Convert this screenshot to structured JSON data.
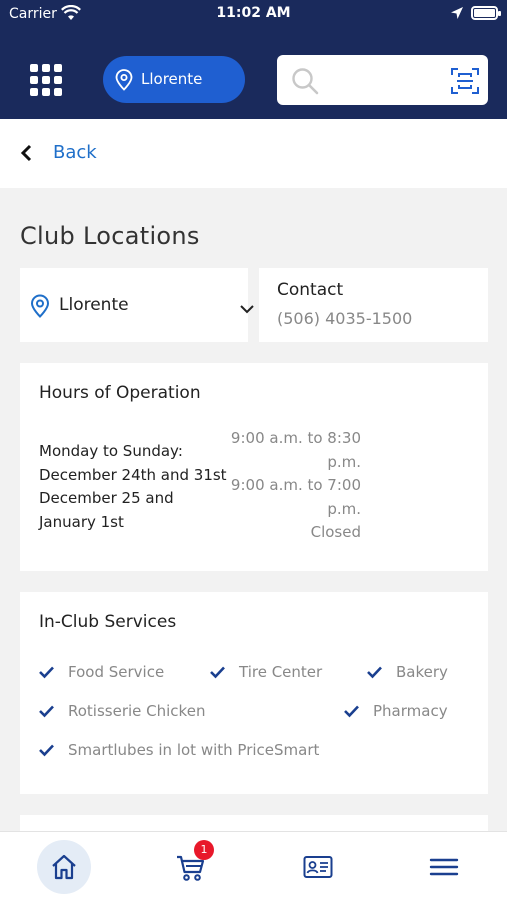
{
  "status_bar": {
    "carrier": "Carrier",
    "time": "11:02 AM"
  },
  "header": {
    "location_label": "Llorente",
    "search_placeholder": ""
  },
  "nav": {
    "back_label": "Back"
  },
  "page": {
    "title": "Club Locations"
  },
  "club_selector": {
    "selected": "Llorente"
  },
  "contact": {
    "heading": "Contact",
    "phone": "(506) 4035-1500"
  },
  "hours": {
    "heading": "Hours of Operation",
    "days": [
      "Monday to Sunday:",
      "December 24th and 31st",
      "December 25 and",
      "January 1st"
    ],
    "times": [
      "9:00 a.m. to 8:30",
      "p.m.",
      "9:00 a.m. to 7:00",
      "p.m.",
      "Closed"
    ]
  },
  "services": {
    "heading": "In-Club Services",
    "items": [
      "Food Service",
      "Tire Center",
      "Bakery",
      "Rotisserie Chicken",
      "Pharmacy",
      "Smartlubes in lot with PriceSmart"
    ]
  },
  "tabbar": {
    "cart_count": "1"
  },
  "colors": {
    "header_bg": "#1a2a5c",
    "accent_blue": "#1f5fd1",
    "link_blue": "#1f6fc9",
    "check_blue": "#1a3f8f",
    "badge_red": "#e8182a"
  }
}
